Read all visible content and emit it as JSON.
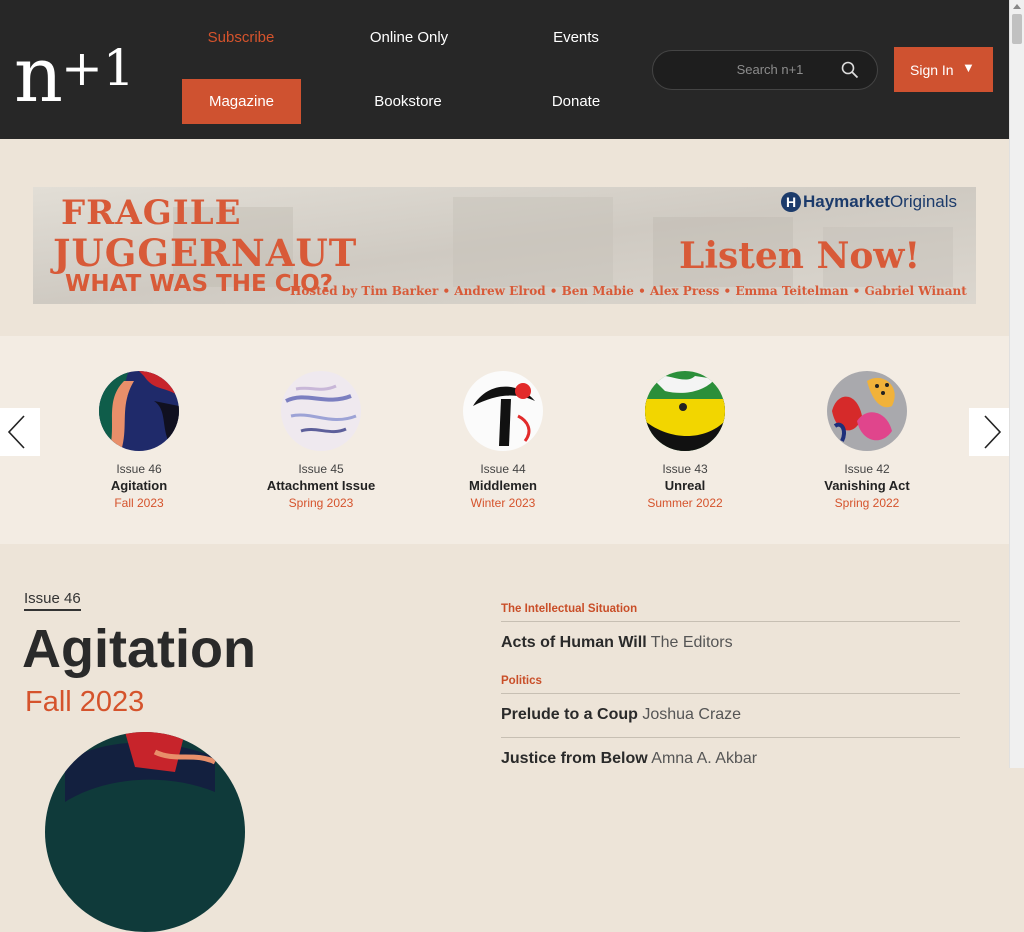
{
  "header": {
    "logo": "n+1",
    "nav": {
      "subscribe": "Subscribe",
      "online_only": "Online Only",
      "events": "Events",
      "magazine": "Magazine",
      "bookstore": "Bookstore",
      "donate": "Donate"
    },
    "search_placeholder": "Search n+1",
    "sign_in": "Sign In",
    "sign_in_arrow": "▼"
  },
  "ad": {
    "line1": "FRAGILE",
    "line2": "JUGGERNAUT",
    "line3": "WHAT WAS THE CIO?",
    "brand": "Haymarket",
    "brand_suffix": "Originals",
    "cta": "Listen Now!",
    "hosts": "Hosted by Tim Barker • Andrew Elrod • Ben Mabie • Alex Press • Emma Teitelman • Gabriel Winant"
  },
  "carousel": {
    "issues": [
      {
        "num": "Issue 46",
        "title": "Agitation",
        "season": "Fall 2023"
      },
      {
        "num": "Issue 45",
        "title": "Attachment Issue",
        "season": "Spring 2023"
      },
      {
        "num": "Issue 44",
        "title": "Middlemen",
        "season": "Winter 2023"
      },
      {
        "num": "Issue 43",
        "title": "Unreal",
        "season": "Summer 2022"
      },
      {
        "num": "Issue 42",
        "title": "Vanishing Act",
        "season": "Spring 2022"
      }
    ]
  },
  "issue": {
    "tag": "Issue 46",
    "title": "Agitation",
    "season": "Fall 2023"
  },
  "toc": {
    "sections": [
      {
        "label": "The Intellectual Situation",
        "articles": [
          {
            "title": "Acts of Human Will",
            "author": "The Editors"
          }
        ]
      },
      {
        "label": "Politics",
        "articles": [
          {
            "title": "Prelude to a Coup",
            "author": "Joshua Craze"
          },
          {
            "title": "Justice from Below",
            "author": "Amna A. Akbar"
          }
        ]
      }
    ]
  },
  "colors": {
    "header_bg": "#272727",
    "accent": "#cf5230",
    "page_bg": "#ede4d8"
  }
}
